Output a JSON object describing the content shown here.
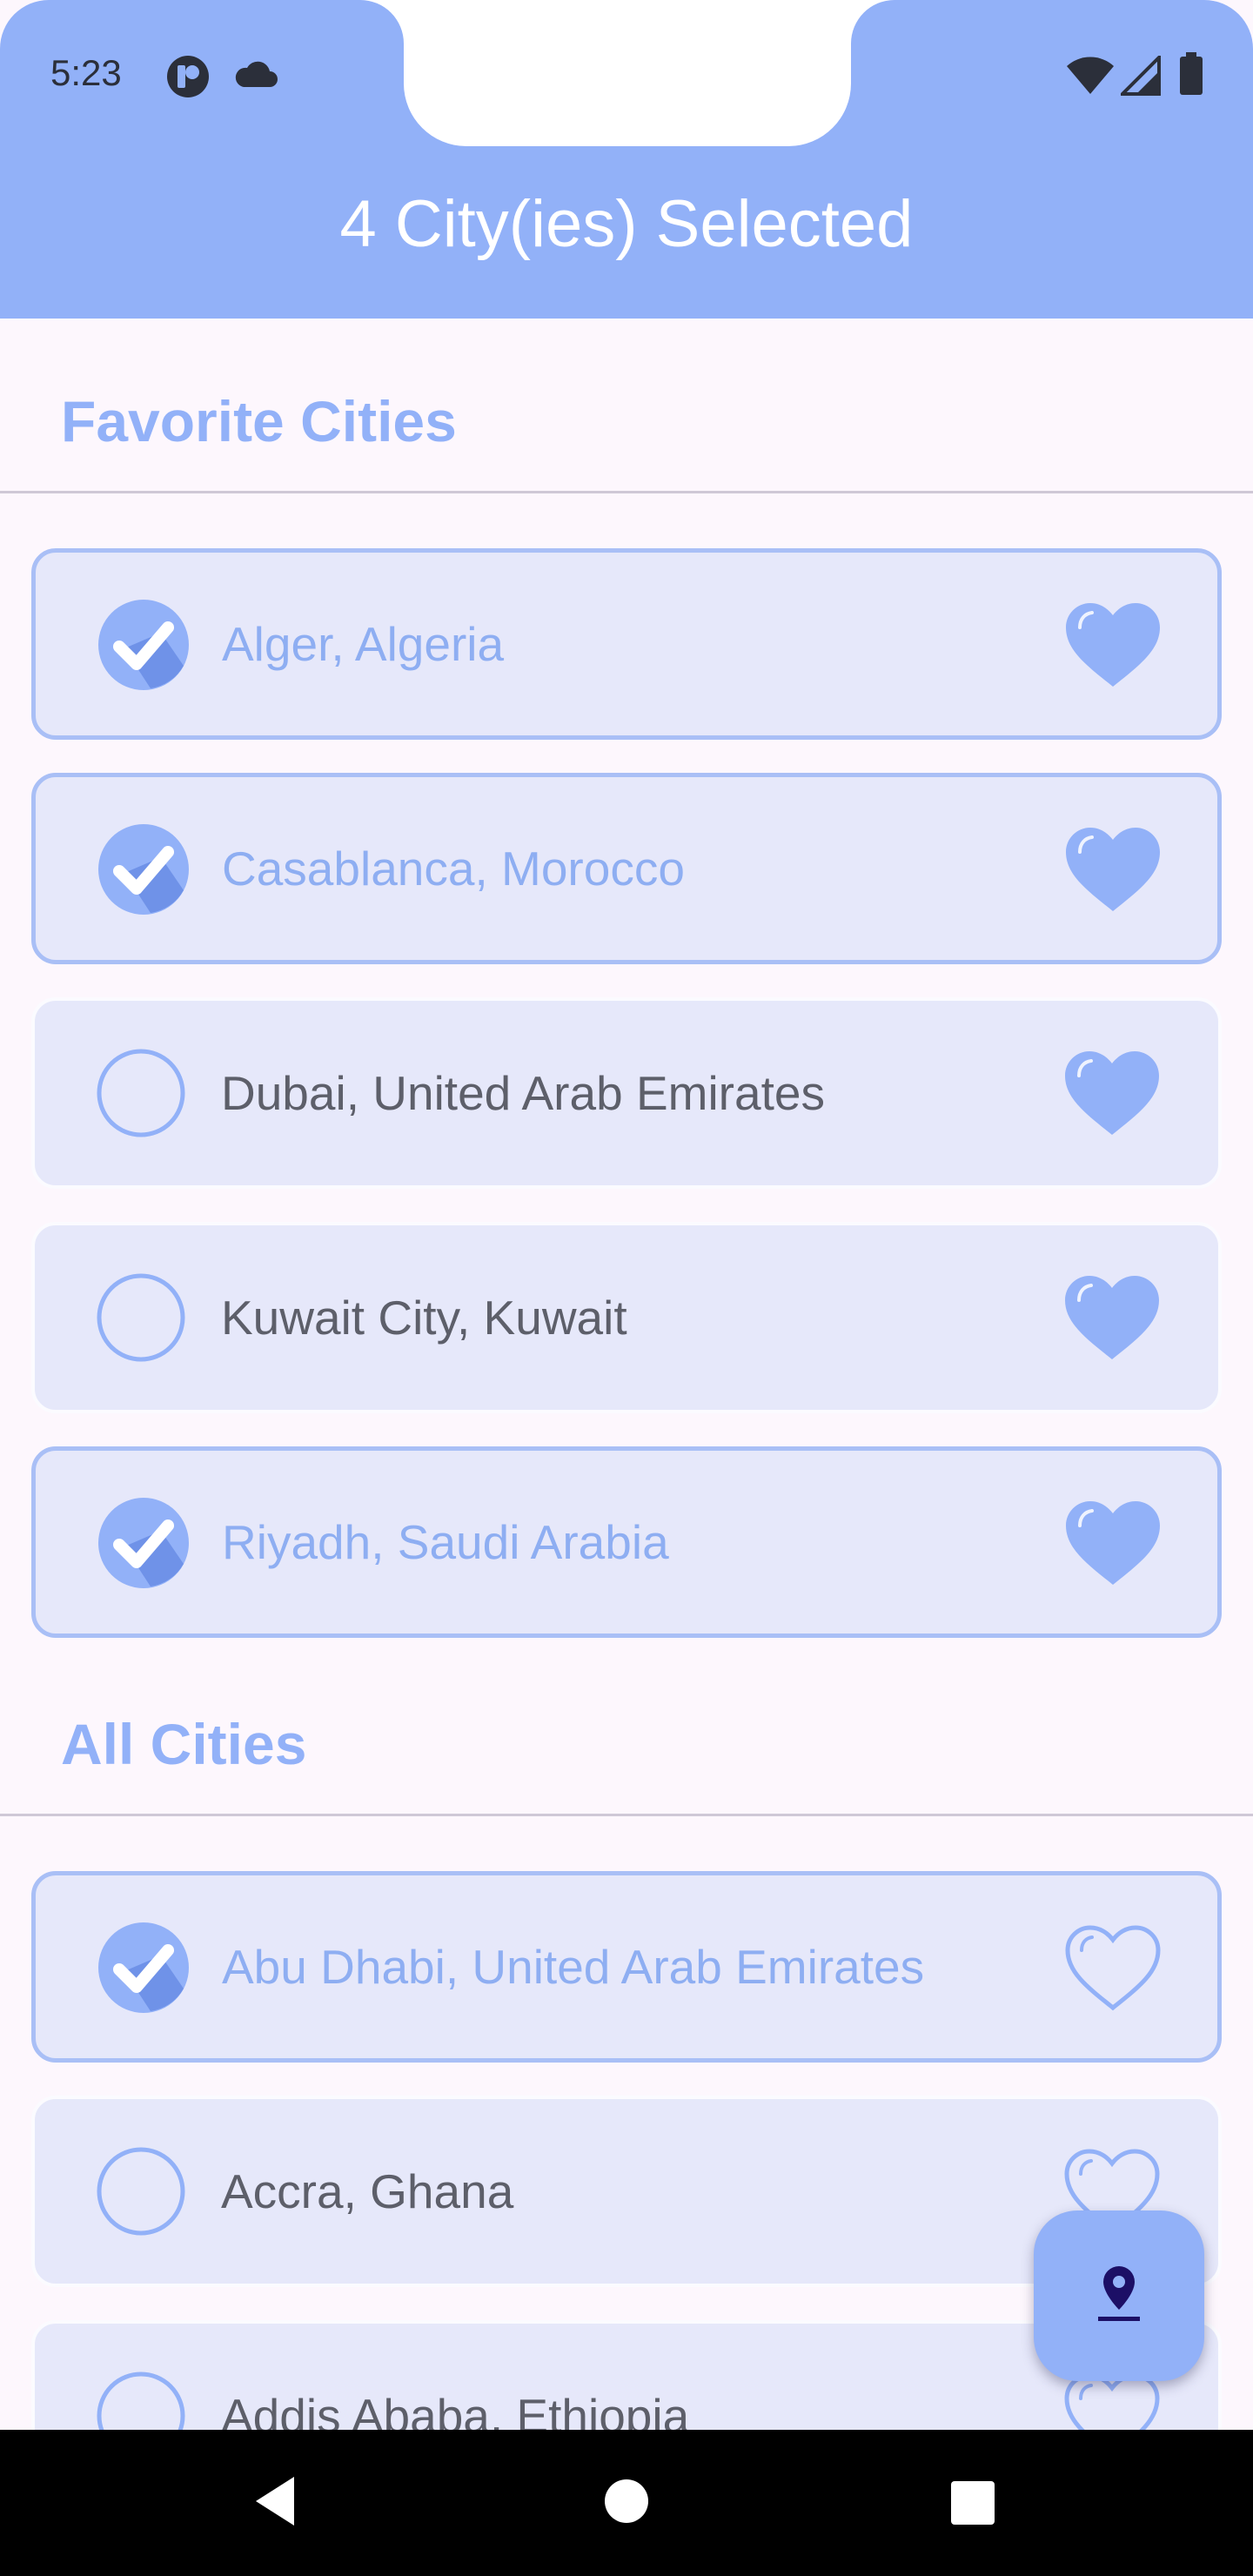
{
  "status_bar": {
    "time": "5:23",
    "icons": [
      "app-notification-icon",
      "cloud-icon",
      "wifi-icon",
      "signal-icon",
      "battery-icon"
    ]
  },
  "app_bar": {
    "title": "4 City(ies) Selected"
  },
  "favorites": {
    "title": "Favorite Cities",
    "items": [
      {
        "label": "Alger, Algeria",
        "selected": true,
        "favorite": true
      },
      {
        "label": "Casablanca, Morocco",
        "selected": true,
        "favorite": true
      },
      {
        "label": "Dubai, United Arab Emirates",
        "selected": false,
        "favorite": true
      },
      {
        "label": "Kuwait City, Kuwait",
        "selected": false,
        "favorite": true
      },
      {
        "label": "Riyadh, Saudi Arabia",
        "selected": true,
        "favorite": true
      }
    ]
  },
  "all_cities": {
    "title": "All Cities",
    "items": [
      {
        "label": "Abu Dhabi, United Arab Emirates",
        "selected": true,
        "favorite": false
      },
      {
        "label": "Accra, Ghana",
        "selected": false,
        "favorite": false
      },
      {
        "label": "Addis Ababa, Ethiopia",
        "selected": false,
        "favorite": false
      }
    ]
  },
  "fab": {
    "icon": "location-pin-icon"
  },
  "colors": {
    "primary": "#92b1f8",
    "card_bg": "#e6e8fa",
    "page_bg": "#fdf7fd",
    "unselected_text": "#5d5f6a"
  }
}
